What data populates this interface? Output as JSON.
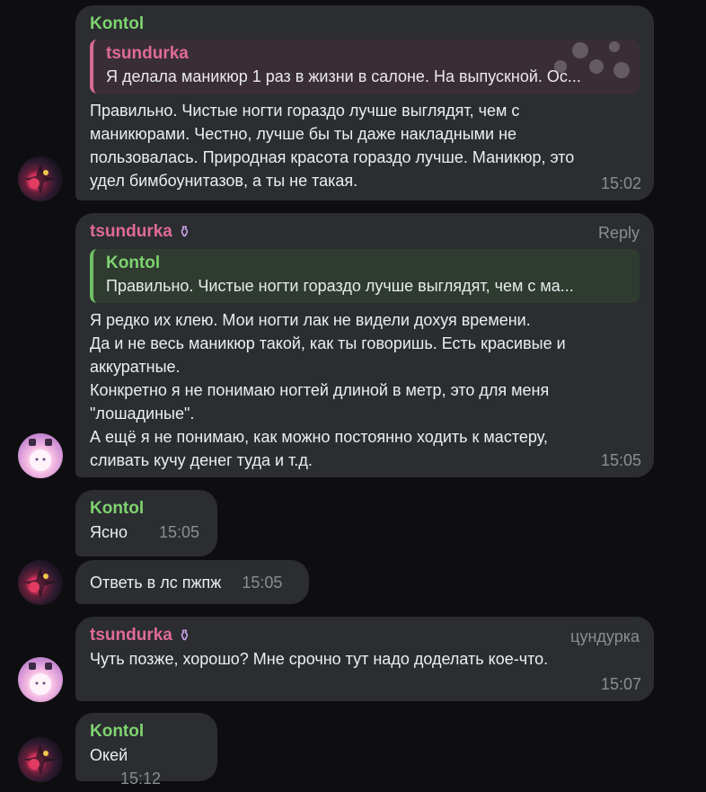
{
  "messages": {
    "m1": {
      "sender": "Kontol",
      "reply_name": "tsundurka",
      "reply_text": "Я делала маникюр 1 раз в жизни в салоне. На выпускной. Ос...",
      "lines": [
        "Правильно. Чистые ногти гораздо лучше выглядят, чем с",
        "маникюрами. Честно, лучше бы ты даже накладными не",
        "пользовалась. Природная красота гораздо лучше. Маникюр, это",
        "удел бимбоунитазов, а ты не такая."
      ],
      "time": "15:02"
    },
    "m2": {
      "sender": "tsundurka",
      "badge": "⚱",
      "tag": "Reply",
      "reply_name": "Kontol",
      "reply_text": "Правильно. Чистые ногти гораздо лучше выглядят, чем с ма...",
      "lines": [
        "Я редко их клею. Мои ногти лак не видели дохуя времени.",
        "Да и не весь маникюр такой, как ты говоришь. Есть красивые и",
        "аккуратные.",
        "Конкретно я не понимаю ногтей длиной в метр, это для меня",
        "\"лошадиные\".",
        "А ещё я не понимаю, как можно постоянно ходить к мастеру,",
        "сливать кучу денег туда и т.д."
      ],
      "time": "15:05"
    },
    "m3": {
      "sender": "Kontol",
      "text": "Ясно",
      "time": "15:05"
    },
    "m4": {
      "text": "Ответь в лс пжпж",
      "time": "15:05"
    },
    "m5": {
      "sender": "tsundurka",
      "badge": "⚱",
      "tag": "цундурка",
      "text": "Чуть позже, хорошо? Мне срочно тут надо доделать кое-что.",
      "time": "15:07"
    },
    "m6": {
      "sender": "Kontol",
      "text": "Окей",
      "time": "15:12"
    }
  },
  "colors": {
    "background": "#0e0e10",
    "bubble": "#2b2d31",
    "name_green": "#7ed36f",
    "name_pink": "#e06a98",
    "time_gray": "#8a8d92"
  },
  "icons": {
    "badge": "coffin-emoji-icon",
    "avatar_kontol": "avatar-dark-floral",
    "avatar_tsundurka": "avatar-pink-anime"
  }
}
